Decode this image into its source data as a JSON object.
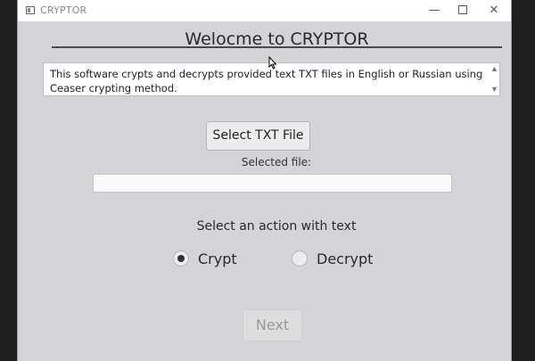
{
  "window": {
    "title": "CRYPTOR",
    "controls": {
      "minimize": "—",
      "close": "✕"
    }
  },
  "main": {
    "heading": "Welocme to CRYPTOR",
    "description": "This software crypts and decrypts provided text TXT files in English or Russian using Ceaser crypting method.",
    "select_button": "Select TXT File",
    "selected_file_label": "Selected file:",
    "selected_file_value": "",
    "action_label": "Select an action with text",
    "options": [
      {
        "label": "Crypt",
        "selected": true
      },
      {
        "label": "Decrypt",
        "selected": false
      }
    ],
    "next_button": "Next",
    "next_enabled": false
  },
  "icons": {
    "app": "app-window-icon",
    "scroll_up": "▲",
    "scroll_down": "▼"
  }
}
